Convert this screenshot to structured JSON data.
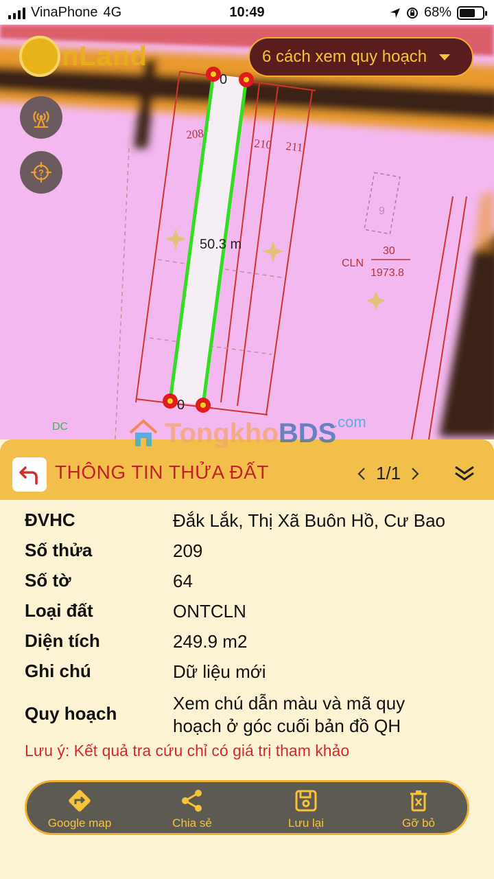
{
  "status_bar": {
    "carrier": "VinaPhone",
    "network": "4G",
    "time": "10:49",
    "battery": "68%",
    "battery_level": 0.68
  },
  "map": {
    "logo_text": "nLand",
    "planning_button": {
      "label": "6 cách xem quy hoạch"
    },
    "measure_label": "50.3 m",
    "parcel_labels": [
      "208",
      "210",
      "211",
      "9"
    ],
    "endpoint_label_top": "0",
    "endpoint_label_bottom": "0",
    "cln_code": "CLN",
    "cln_numerator": "30",
    "cln_denominator": "1973.8",
    "dc_label": "DC",
    "watermark": {
      "text_prefix": "Tongkho",
      "text_suffix": "BDS",
      "com": ".com"
    },
    "colors": {
      "land": "#f4b8f0",
      "road": "#e99a2e",
      "line": "#d0332b",
      "measure": "#33dd22"
    }
  },
  "panel": {
    "title": "THÔNG TIN THỬA ĐẤT",
    "pager": "1/1",
    "rows": [
      {
        "label": "ĐVHC",
        "value": "Đắk Lắk, Thị Xã Buôn Hồ, Cư Bao"
      },
      {
        "label": "Số thửa",
        "value": "209"
      },
      {
        "label": "Số tờ",
        "value": "64"
      },
      {
        "label": "Loại đất",
        "value": "ONTCLN"
      },
      {
        "label": "Diện tích",
        "value": "249.9 m2"
      },
      {
        "label": "Ghi chú",
        "value": "Dữ liệu mới"
      },
      {
        "label": "Quy hoạch",
        "value_line1": "Xem chú dẫn màu và mã quy",
        "value_line2": "hoạch ở góc cuối bản đồ QH"
      }
    ],
    "note": "Lưu ý: Kết quả tra cứu chỉ có giá trị tham khảo"
  },
  "toolbar": {
    "google_map": "Google map",
    "share": "Chia sẻ",
    "save": "Lưu lại",
    "remove": "Gỡ bỏ"
  }
}
